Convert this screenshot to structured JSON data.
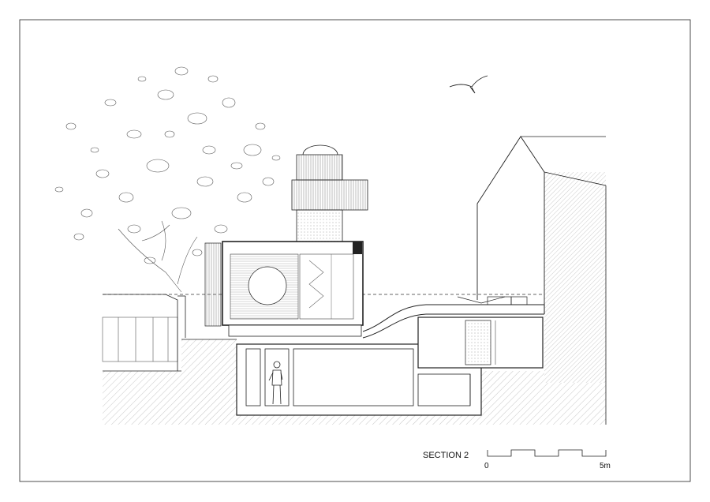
{
  "section": {
    "title": "SECTION 2"
  },
  "scale_bar": {
    "start_label": "0",
    "end_label": "5m",
    "segments": 5
  },
  "colors": {
    "line": "#222222",
    "hatch": "#9a9a9a",
    "paper": "#ffffff"
  },
  "icons": {
    "bird": "seagull-silhouette",
    "person": "standing-woman-figure",
    "tree": "tree-foliage-outline"
  }
}
